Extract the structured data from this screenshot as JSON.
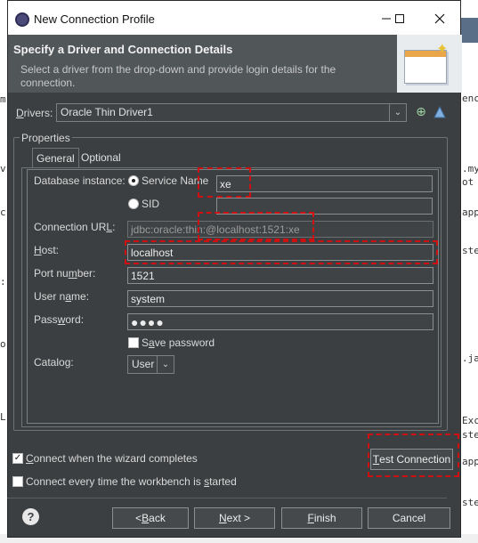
{
  "window": {
    "title": "New Connection Profile"
  },
  "header": {
    "title": "Specify a Driver and Connection Details",
    "description": "Select a driver from the drop-down and provide login details for the connection."
  },
  "drivers": {
    "label": "Drivers:",
    "value": "Oracle Thin Driver1"
  },
  "properties": {
    "group_label": "Properties",
    "tabs": [
      "General",
      "Optional"
    ],
    "database_instance_label": "Database instance:",
    "service_name_label": "Service Name",
    "sid_label": "SID",
    "service_name_value": "xe",
    "sid_value": "",
    "connection_url_label": "Connection URL:",
    "connection_url_value": "jdbc:oracle:thin:@localhost:1521:xe",
    "host_label": "Host:",
    "host_value": "localhost",
    "port_label": "Port number:",
    "port_value": "1521",
    "user_label": "User name:",
    "user_value": "system",
    "password_label": "Password:",
    "password_value": "●●●●",
    "save_password_label": "Save password",
    "catalog_label": "Catalog:",
    "catalog_value": "User"
  },
  "options": {
    "connect_when_completes": "Connect when the wizard completes",
    "connect_every_time": "Connect every time the workbench is started"
  },
  "buttons": {
    "test_connection": "Test Connection",
    "back": "< Back",
    "next": "Next >",
    "finish": "Finish",
    "cancel": "Cancel"
  },
  "background_code": [
    "ence",
    ".my",
    "ot",
    "app",
    "ste",
    ".ja",
    "Exc",
    "ste",
    "app",
    "ste"
  ],
  "colors": {
    "highlight": "#d01010",
    "dialog_bg": "#3c3f41",
    "header_bg": "#515658"
  }
}
